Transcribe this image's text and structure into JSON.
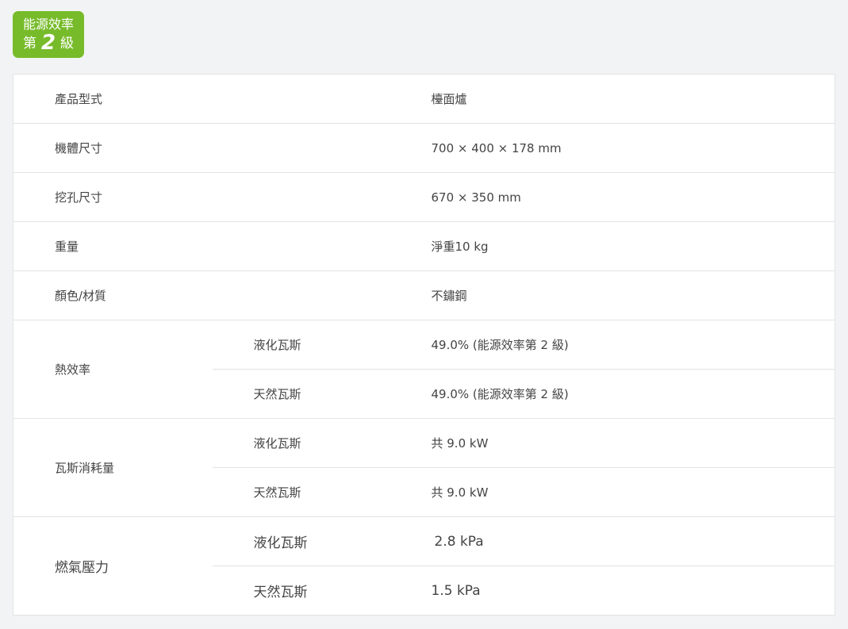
{
  "badge": {
    "line1": "能源效率",
    "prefix": "第",
    "grade": "2",
    "suffix": "級",
    "color": "#77bb2a"
  },
  "specs": {
    "model_type": {
      "label": "產品型式",
      "value": "檯面爐"
    },
    "dimensions": {
      "label": "機體尺寸",
      "value": "700 × 400 × 178 mm"
    },
    "cutout": {
      "label": "挖孔尺寸",
      "value": "670 × 350 mm"
    },
    "weight": {
      "label": "重量",
      "value": "淨重10 kg"
    },
    "color_material": {
      "label": "顏色/材質",
      "value": "不鏽鋼"
    },
    "thermal_efficiency": {
      "label": "熱效率",
      "lpg": {
        "label": "液化瓦斯",
        "value": "49.0%  (能源效率第 2 級)"
      },
      "ng": {
        "label": "天然瓦斯",
        "value": "49.0%  (能源效率第 2 級)"
      }
    },
    "gas_consumption": {
      "label": "瓦斯消耗量",
      "lpg": {
        "label": "液化瓦斯",
        "value": "共 9.0 kW"
      },
      "ng": {
        "label": "天然瓦斯",
        "value": "共 9.0 kW"
      }
    },
    "gas_pressure": {
      "label": "燃氣壓力",
      "lpg": {
        "label": "液化瓦斯",
        "value": "2.8 kPa"
      },
      "ng": {
        "label": "天然瓦斯",
        "value": "1.5 kPa"
      }
    }
  }
}
